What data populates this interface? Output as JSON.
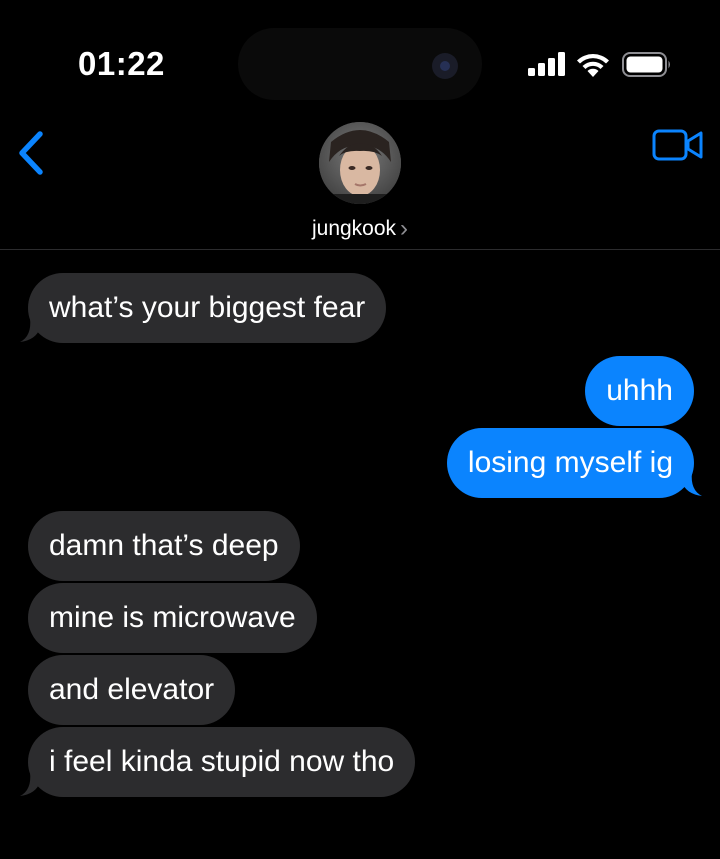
{
  "status_bar": {
    "time": "01:22",
    "icons": [
      "signal-icon",
      "wifi-icon",
      "battery-icon"
    ]
  },
  "header": {
    "contact_name": "jungkook",
    "chevron": "›",
    "icons": [
      "back-chevron-icon",
      "video-call-icon",
      "avatar"
    ]
  },
  "colors": {
    "accent": "#0b84fe",
    "incoming_bubble": "#2c2c2e",
    "outgoing_bubble": "#0b84fe",
    "background": "#000000"
  },
  "messages": [
    {
      "direction": "in",
      "text": "what’s your biggest fear"
    },
    {
      "direction": "out",
      "text": "uhhh"
    },
    {
      "direction": "out",
      "text": "losing myself ig"
    },
    {
      "direction": "in",
      "text": "damn that’s deep"
    },
    {
      "direction": "in",
      "text": "mine is microwave"
    },
    {
      "direction": "in",
      "text": "and elevator"
    },
    {
      "direction": "in",
      "text": "i feel kinda stupid now tho"
    }
  ]
}
